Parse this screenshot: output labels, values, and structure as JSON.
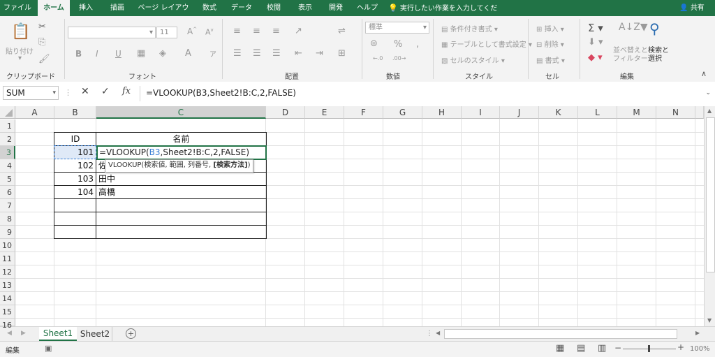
{
  "menu": {
    "tabs": [
      "ファイル",
      "ホーム",
      "挿入",
      "描画",
      "ページ レイアウト",
      "数式",
      "データ",
      "校閲",
      "表示",
      "開発",
      "ヘルプ"
    ],
    "active_tab": "ホーム",
    "tell_me": "実行したい作業を入力してください",
    "share": "共有"
  },
  "ribbon": {
    "clipboard": {
      "paste": "貼り付け",
      "label": "クリップボード"
    },
    "font": {
      "size": "11",
      "label": "フォント",
      "bold": "B",
      "italic": "I",
      "underline": "U"
    },
    "alignment": {
      "label": "配置"
    },
    "number": {
      "format": "標準",
      "label": "数値",
      "percent": "%"
    },
    "styles": {
      "conditional": "条件付き書式",
      "table": "テーブルとして書式設定",
      "cell_styles": "セルのスタイル",
      "label": "スタイル"
    },
    "cells": {
      "insert": "挿入",
      "delete": "削除",
      "format": "書式",
      "label": "セル"
    },
    "editing": {
      "sort_filter_1": "並べ替えと",
      "sort_filter_2": "フィルター",
      "find_1": "検索と",
      "find_2": "選択",
      "label": "編集"
    }
  },
  "formula_bar": {
    "name_box": "SUM",
    "fx": "fx",
    "formula": "=VLOOKUP(B3,Sheet2!B:C,2,FALSE)"
  },
  "grid": {
    "columns": [
      "A",
      "B",
      "C",
      "D",
      "E",
      "F",
      "G",
      "H",
      "I",
      "J",
      "K",
      "L",
      "M",
      "N"
    ],
    "selected_column": "C",
    "rows": [
      "1",
      "2",
      "3",
      "4",
      "5",
      "6",
      "7",
      "8",
      "9",
      "10",
      "11",
      "12",
      "13",
      "14",
      "15",
      "16"
    ],
    "selected_row": "3",
    "table": {
      "header_id": "ID",
      "header_name": "名前",
      "ids": [
        "101",
        "102",
        "103",
        "104"
      ],
      "names": [
        "",
        "佐",
        "田中",
        "高橋"
      ]
    },
    "edit_cell": {
      "prefix": "=VLOOKUP(",
      "ref": "B3",
      "suffix": ",Sheet2!B:C,2,FALSE)"
    },
    "tooltip": {
      "text": "VLOOKUP(検索値, 範囲, 列番号, ",
      "bold": "[検索方法]",
      "end": ")"
    }
  },
  "sheets": {
    "tabs": [
      "Sheet1",
      "Sheet2"
    ],
    "active": "Sheet1"
  },
  "status": {
    "mode": "編集",
    "zoom": "100%"
  },
  "colors": {
    "accent": "#217346",
    "ref_blue": "#3a7fd5"
  }
}
